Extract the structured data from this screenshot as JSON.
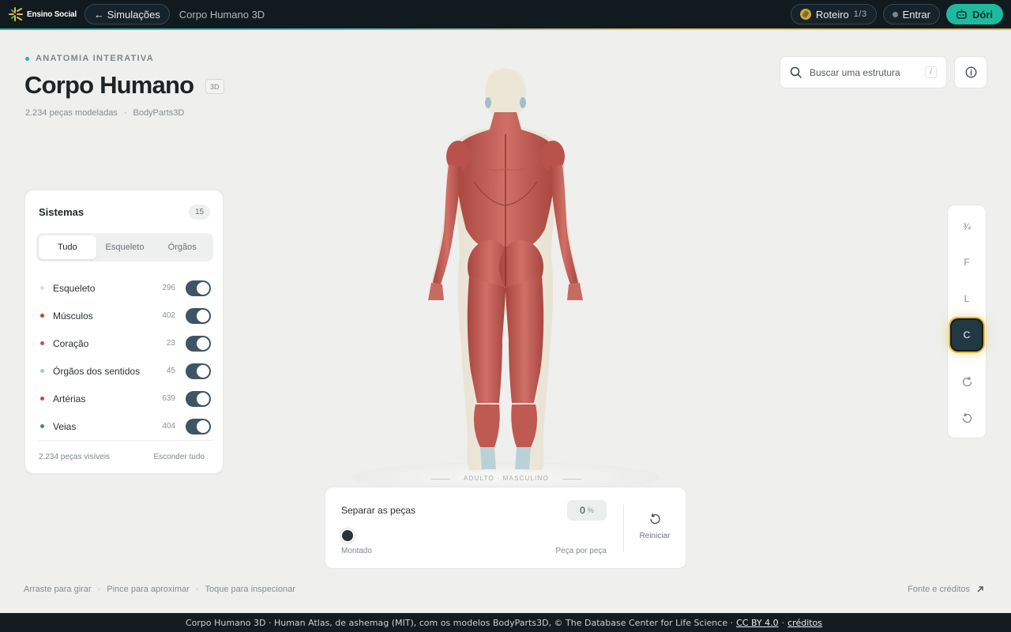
{
  "topbar": {
    "brand": "Ensino Social",
    "back": "← Simulações",
    "crumb": "Corpo Humano 3D",
    "roteiro_label": "Roteiro",
    "roteiro_count": "1/3",
    "login": "Entrar",
    "assistant": "Dóri"
  },
  "header": {
    "eyebrow": "ANATOMIA INTERATIVA",
    "title": "Corpo Humano",
    "badge": "3D",
    "pieces": "2.234 peças modeladas",
    "sep": "·",
    "source": "BodyParts3D"
  },
  "search": {
    "placeholder": "Buscar uma estrutura",
    "shortcut": "/"
  },
  "systems": {
    "title": "Sistemas",
    "count": "15",
    "tabs": [
      {
        "label": "Tudo",
        "active": true
      },
      {
        "label": "Esqueleto",
        "active": false
      },
      {
        "label": "Órgãos",
        "active": false
      }
    ],
    "items": [
      {
        "label": "Esqueleto",
        "count": "296",
        "color": "#e6dfcb",
        "on": true
      },
      {
        "label": "Músculos",
        "count": "402",
        "color": "#b5473d",
        "on": true
      },
      {
        "label": "Coração",
        "count": "23",
        "color": "#c0554e",
        "on": true
      },
      {
        "label": "Órgãos dos sentidos",
        "count": "45",
        "color": "#a9c7cf",
        "on": true
      },
      {
        "label": "Artérias",
        "count": "639",
        "color": "#c24a3c",
        "on": true
      },
      {
        "label": "Veias",
        "count": "404",
        "color": "#4f7f9a",
        "on": true
      }
    ],
    "visible": "2.234 peças visíveis",
    "hide_all": "Esconder tudo"
  },
  "stage": {
    "mode_label": "ADULTO · MASCULINO"
  },
  "views": [
    {
      "label": "¾",
      "active": false
    },
    {
      "label": "F",
      "active": false
    },
    {
      "label": "L",
      "active": false
    },
    {
      "label": "C",
      "active": true
    }
  ],
  "explode": {
    "title": "Separar as peças",
    "value": "0",
    "unit": "%",
    "level": 0,
    "left_label": "Montado",
    "right_label": "Peça por peça",
    "reset": "Reiniciar"
  },
  "hints": {
    "rotate": "Arraste para girar",
    "zoom": "Pince para aproximar",
    "inspect": "Toque para inspecionar",
    "sep": "·",
    "credits": "Fonte e créditos"
  },
  "footer": {
    "text": "Corpo Humano 3D · Human Atlas, de ashemag (MIT), com os modelos BodyParts3D, © The Database Center for Life Science ·",
    "license": "CC BY 4.0",
    "sep": "·",
    "credits": "créditos"
  },
  "colors": {
    "accent": "#1fb99f",
    "highlight": "#e2bb3d",
    "toggle_on": "#3f5563",
    "muscle": "#c0605a"
  }
}
